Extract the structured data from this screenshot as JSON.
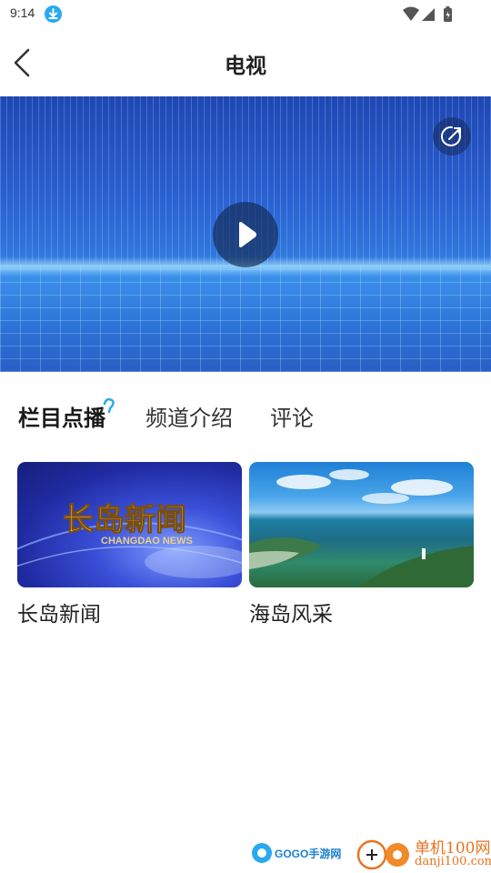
{
  "status_bar": {
    "time": "9:14",
    "icons": [
      "download-icon",
      "wifi-icon",
      "signal-icon",
      "battery-icon"
    ]
  },
  "header": {
    "title": "电视",
    "back_icon": "chevron-left-icon"
  },
  "video": {
    "play_icon": "play-icon",
    "share_icon": "share-icon"
  },
  "tabs": [
    {
      "label": "栏目点播",
      "active": true
    },
    {
      "label": "频道介绍",
      "active": false
    },
    {
      "label": "评论",
      "active": false
    }
  ],
  "programs": [
    {
      "title": "长岛新闻",
      "thumb_text": "长岛新闻",
      "thumb_subtext": "CHANGDAO NEWS"
    },
    {
      "title": "海岛风采"
    }
  ],
  "watermarks": {
    "gogo": "GOGO手游网",
    "danji_title": "单机100网",
    "danji_url": "danji100.com"
  },
  "colors": {
    "accent": "#29a9f0",
    "danji_orange": "#e8731f"
  }
}
